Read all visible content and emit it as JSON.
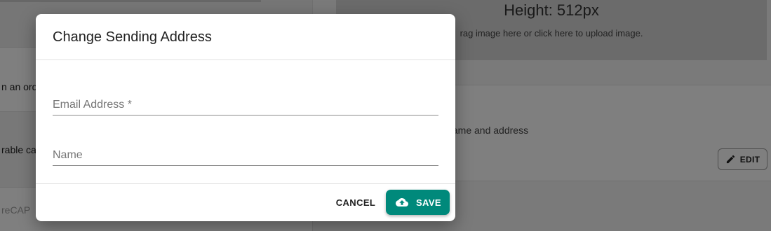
{
  "background": {
    "left": {
      "row1_text": "n an orde",
      "row2_text": "rable cat",
      "row3_text": "reCAP"
    },
    "right": {
      "upload_heading": "Height: 512px",
      "upload_hint": "rag image here or click here to upload image.",
      "sender_description": "il name and address",
      "edit_label": "EDIT",
      "edit_icon": "pencil-icon"
    }
  },
  "modal": {
    "title": "Change Sending Address",
    "fields": [
      {
        "placeholder": "Email Address *",
        "value": ""
      },
      {
        "placeholder": "Name",
        "value": ""
      }
    ],
    "cancel_label": "CANCEL",
    "save_label": "SAVE",
    "save_icon": "cloud-upload-icon",
    "accent_color": "#00897b"
  }
}
